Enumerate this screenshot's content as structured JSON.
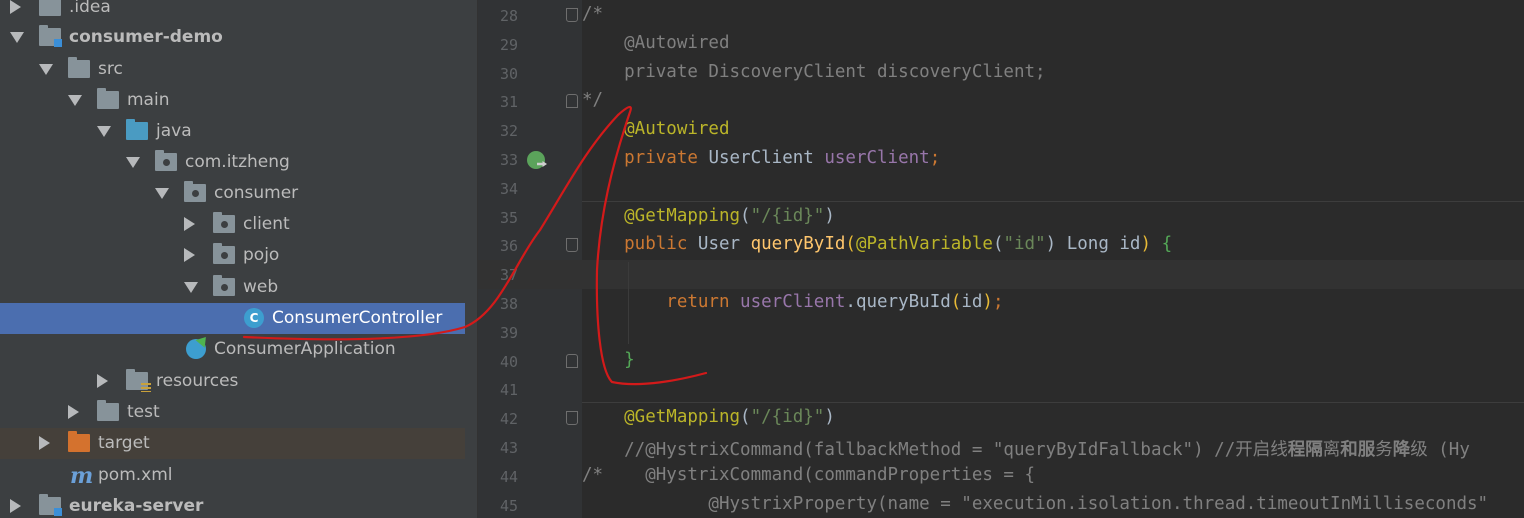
{
  "project_tree": {
    "items": [
      {
        "label": ".idea",
        "type": "folder"
      },
      {
        "label": "consumer-demo",
        "type": "module"
      },
      {
        "label": "src",
        "type": "folder"
      },
      {
        "label": "main",
        "type": "folder"
      },
      {
        "label": "java",
        "type": "source-folder"
      },
      {
        "label": "com.itzheng",
        "type": "package"
      },
      {
        "label": "consumer",
        "type": "package"
      },
      {
        "label": "client",
        "type": "package"
      },
      {
        "label": "pojo",
        "type": "package"
      },
      {
        "label": "web",
        "type": "package"
      },
      {
        "label": "ConsumerController",
        "type": "class",
        "selected": true
      },
      {
        "label": "ConsumerApplication",
        "type": "spring-class"
      },
      {
        "label": "resources",
        "type": "resources-folder"
      },
      {
        "label": "test",
        "type": "folder"
      },
      {
        "label": "target",
        "type": "excluded-folder"
      },
      {
        "label": "pom.xml",
        "type": "maven-file"
      },
      {
        "label": "eureka-server",
        "type": "module"
      }
    ],
    "class_icon_letter": "C"
  },
  "editor": {
    "line_numbers": [
      "28",
      "29",
      "30",
      "31",
      "32",
      "33",
      "34",
      "35",
      "36",
      "37",
      "38",
      "39",
      "40",
      "41",
      "42",
      "43",
      "44",
      "45"
    ],
    "lines": [
      [
        {
          "t": "c",
          "v": "/*"
        }
      ],
      [
        {
          "t": "c",
          "v": "    @Autowired"
        }
      ],
      [
        {
          "t": "c",
          "v": "    private DiscoveryClient discoveryClient;"
        }
      ],
      [
        {
          "t": "c",
          "v": "*/"
        }
      ],
      [
        {
          "t": "a",
          "v": "    @Autowired"
        }
      ],
      [
        {
          "t": "k",
          "v": "    private "
        },
        {
          "t": "n",
          "v": "UserClient "
        },
        {
          "t": "f",
          "v": "userClient"
        },
        {
          "t": "k",
          "v": ";"
        }
      ],
      [],
      [
        {
          "t": "a",
          "v": "    @GetMapping"
        },
        {
          "t": "n",
          "v": "("
        },
        {
          "t": "s",
          "v": "\"/{id}\""
        },
        {
          "t": "n",
          "v": ")"
        }
      ],
      [
        {
          "t": "k",
          "v": "    public "
        },
        {
          "t": "n",
          "v": "User "
        },
        {
          "t": "m",
          "v": "queryById"
        },
        {
          "t": "br",
          "v": "("
        },
        {
          "t": "a",
          "v": "@PathVariable"
        },
        {
          "t": "n",
          "v": "("
        },
        {
          "t": "s",
          "v": "\"id\""
        },
        {
          "t": "n",
          "v": ") Long id"
        },
        {
          "t": "br",
          "v": ")"
        },
        {
          "t": "n",
          "v": " "
        },
        {
          "t": "pg",
          "v": "{"
        }
      ],
      [],
      [
        {
          "t": "k",
          "v": "        return "
        },
        {
          "t": "f",
          "v": "userClient"
        },
        {
          "t": "n",
          "v": ".queryBuId"
        },
        {
          "t": "br",
          "v": "("
        },
        {
          "t": "n",
          "v": "id"
        },
        {
          "t": "br",
          "v": ")"
        },
        {
          "t": "k",
          "v": ";"
        }
      ],
      [],
      [
        {
          "t": "pg",
          "v": "    }"
        }
      ],
      [],
      [
        {
          "t": "a",
          "v": "    @GetMapping"
        },
        {
          "t": "n",
          "v": "("
        },
        {
          "t": "s",
          "v": "\"/{id}\""
        },
        {
          "t": "n",
          "v": ")"
        }
      ],
      [
        {
          "t": "c",
          "v": "    //@HystrixCommand(fallbackMethod = \"queryByIdFallback\") //开启线"
        },
        {
          "t": "cb",
          "v": "程隔"
        },
        {
          "t": "c",
          "v": "离"
        },
        {
          "t": "cb",
          "v": "和服"
        },
        {
          "t": "c",
          "v": "务"
        },
        {
          "t": "cb",
          "v": "降"
        },
        {
          "t": "c",
          "v": "级 (Hy"
        }
      ],
      [
        {
          "t": "c",
          "v": "/*    @HystrixCommand(commandProperties = {"
        }
      ],
      [
        {
          "t": "c",
          "v": "            @HystrixProperty(name = \"execution.isolation.thread.timeoutInMilliseconds\""
        }
      ]
    ]
  }
}
